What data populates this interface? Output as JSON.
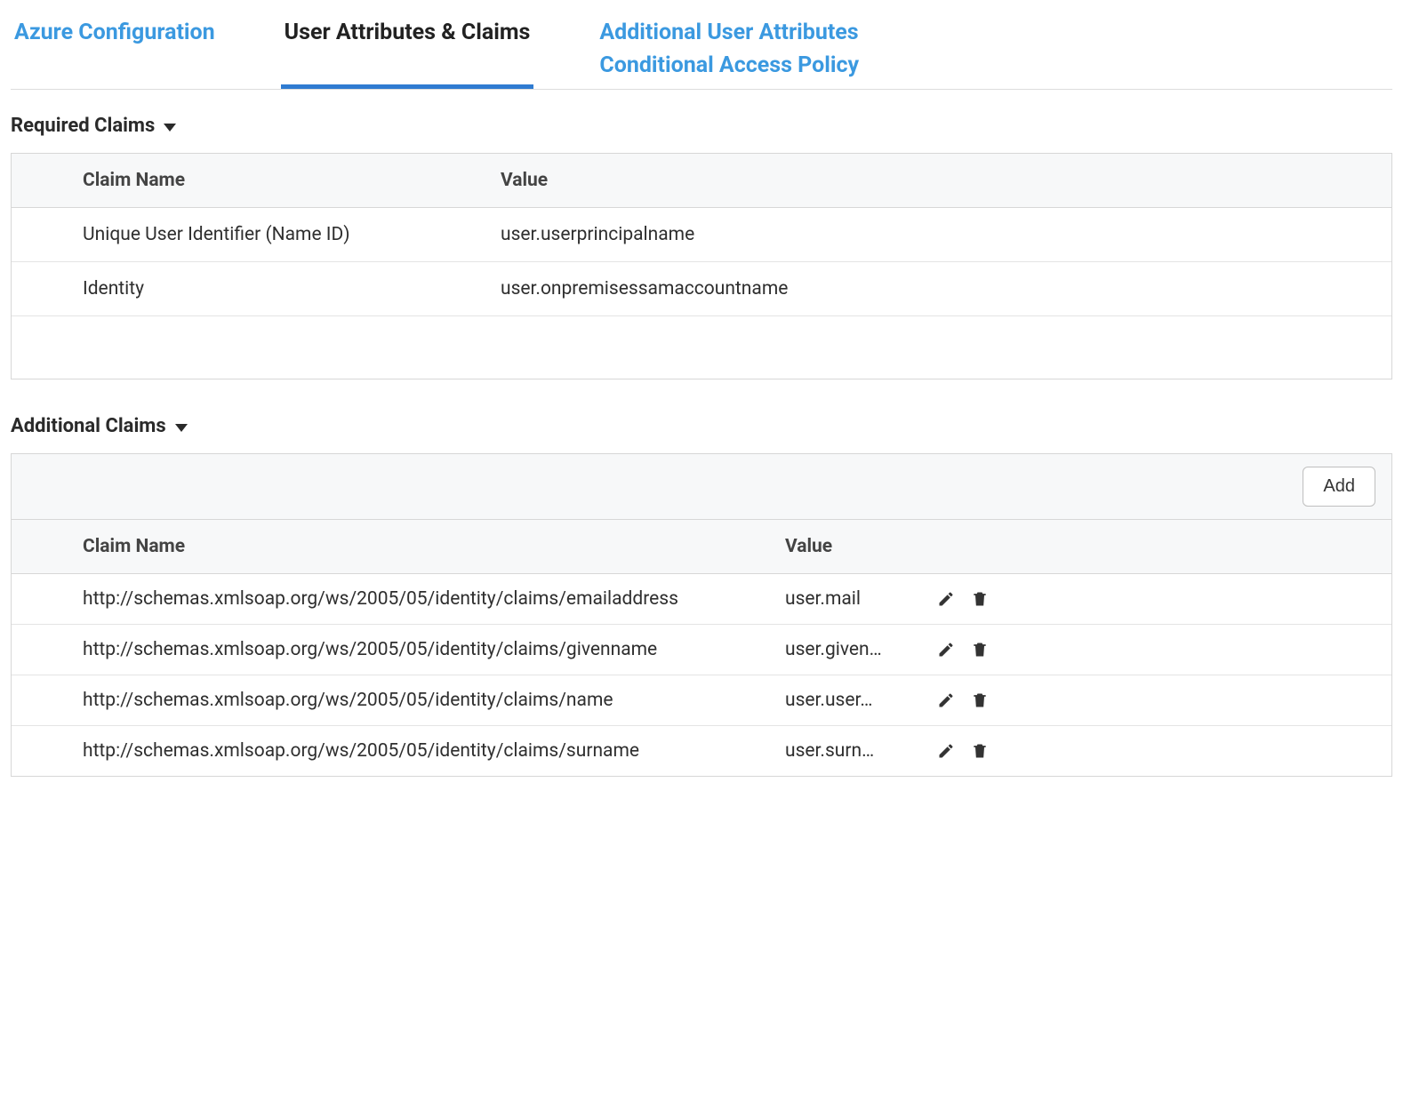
{
  "tabs": {
    "azure_config": "Azure Configuration",
    "user_attrs": "User Attributes & Claims",
    "additional_attrs": "Additional User Attributes",
    "conditional_policy": "Conditional Access Policy"
  },
  "sections": {
    "required": {
      "title": "Required Claims",
      "columns": {
        "name": "Claim Name",
        "value": "Value"
      },
      "rows": [
        {
          "name": "Unique User Identifier (Name ID)",
          "value": "user.userprincipalname"
        },
        {
          "name": "Identity",
          "value": "user.onpremisessamaccountname"
        }
      ]
    },
    "additional": {
      "title": "Additional Claims",
      "add_label": "Add",
      "columns": {
        "name": "Claim Name",
        "value": "Value"
      },
      "rows": [
        {
          "name": "http://schemas.xmlsoap.org/ws/2005/05/identity/claims/emailaddress",
          "value": "user.mail"
        },
        {
          "name": "http://schemas.xmlsoap.org/ws/2005/05/identity/claims/givenname",
          "value": "user.given…"
        },
        {
          "name": "http://schemas.xmlsoap.org/ws/2005/05/identity/claims/name",
          "value": "user.user…"
        },
        {
          "name": "http://schemas.xmlsoap.org/ws/2005/05/identity/claims/surname",
          "value": "user.surn…"
        }
      ]
    }
  }
}
